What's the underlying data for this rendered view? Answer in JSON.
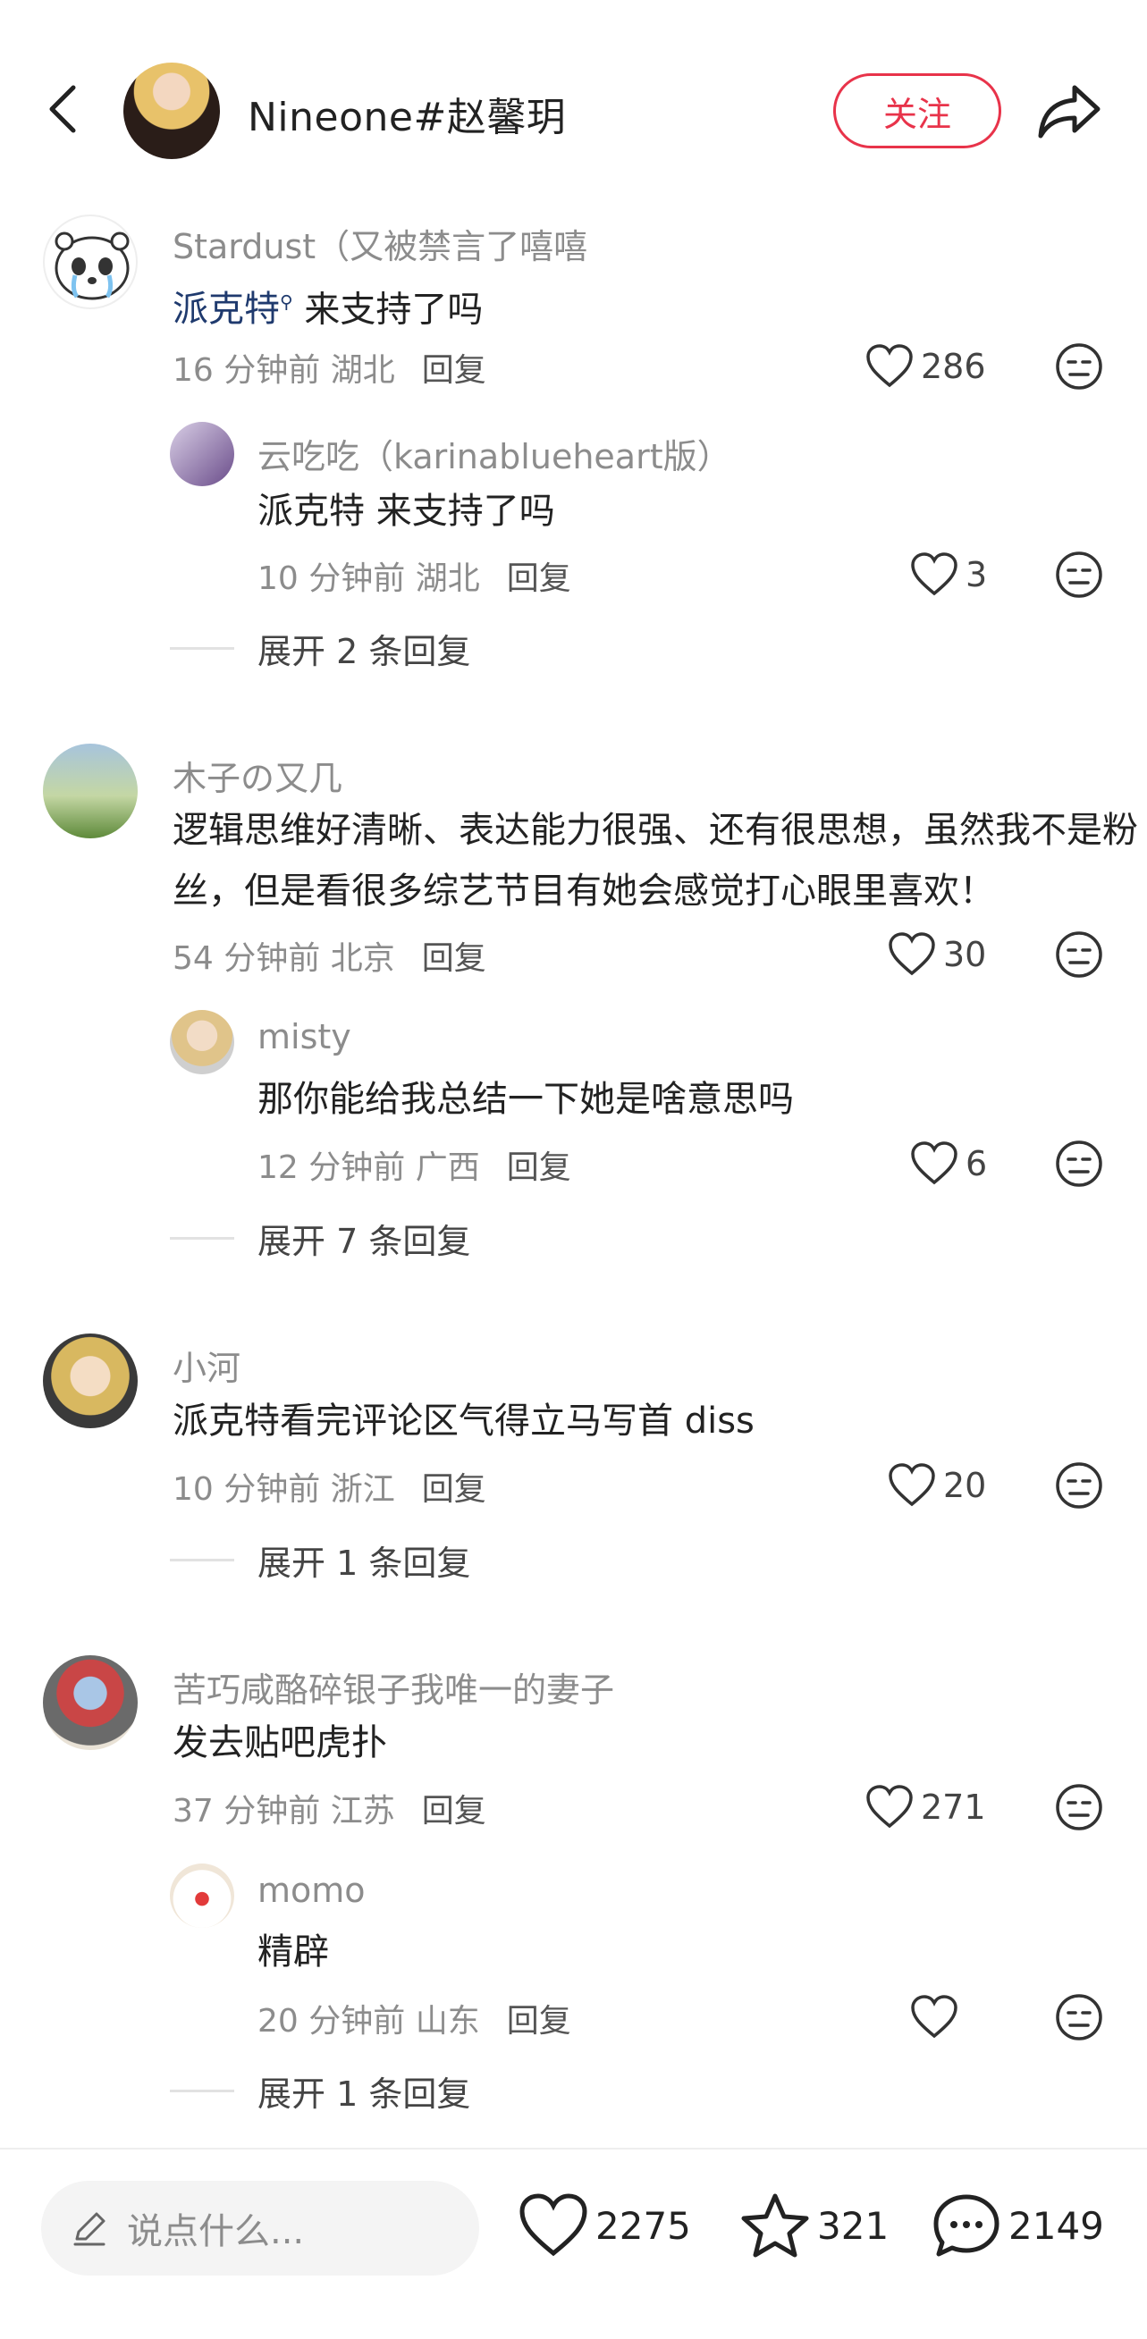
{
  "header": {
    "author_name": "Nineone#赵馨玥",
    "follow_label": "关注"
  },
  "comments": [
    {
      "user": "Stardust（又被禁言了嘻嘻",
      "text_link": "派克特",
      "text_rest": " 来支持了吗",
      "time": "16 分钟前",
      "location": "湖北",
      "reply_label": "回复",
      "likes": "286",
      "reply": {
        "user": "云吃吃（karinablueheart版）",
        "text": "派克特  来支持了吗",
        "time": "10 分钟前",
        "location": "湖北",
        "reply_label": "回复",
        "likes": "3"
      },
      "expand": "展开 2 条回复"
    },
    {
      "user": "木子の又几",
      "text": "逻辑思维好清晰、表达能力很强、还有很思想，虽然我不是粉丝，但是看很多综艺节目有她会感觉打心眼里喜欢！",
      "time": "54 分钟前",
      "location": "北京",
      "reply_label": "回复",
      "likes": "30",
      "reply": {
        "user": "misty",
        "text": "那你能给我总结一下她是啥意思吗",
        "time": "12 分钟前",
        "location": "广西",
        "reply_label": "回复",
        "likes": "6"
      },
      "expand": "展开 7 条回复"
    },
    {
      "user": "小河",
      "text": "派克特看完评论区气得立马写首 diss",
      "time": "10 分钟前",
      "location": "浙江",
      "reply_label": "回复",
      "likes": "20",
      "expand": "展开 1 条回复"
    },
    {
      "user": "苦巧咸酪碎银子我唯一的妻子",
      "text": "发去贴吧虎扑",
      "time": "37 分钟前",
      "location": "江苏",
      "reply_label": "回复",
      "likes": "271",
      "reply": {
        "user": "momo",
        "text": "精辟",
        "time": "20 分钟前",
        "location": "山东",
        "reply_label": "回复",
        "likes": ""
      },
      "expand": "展开 1 条回复"
    }
  ],
  "bottom_bar": {
    "placeholder": "说点什么...",
    "likes": "2275",
    "favorites": "321",
    "comments": "2149"
  },
  "colors": {
    "accent": "#e8334a",
    "link": "#1f3a6e",
    "muted": "#8c8c8c"
  }
}
